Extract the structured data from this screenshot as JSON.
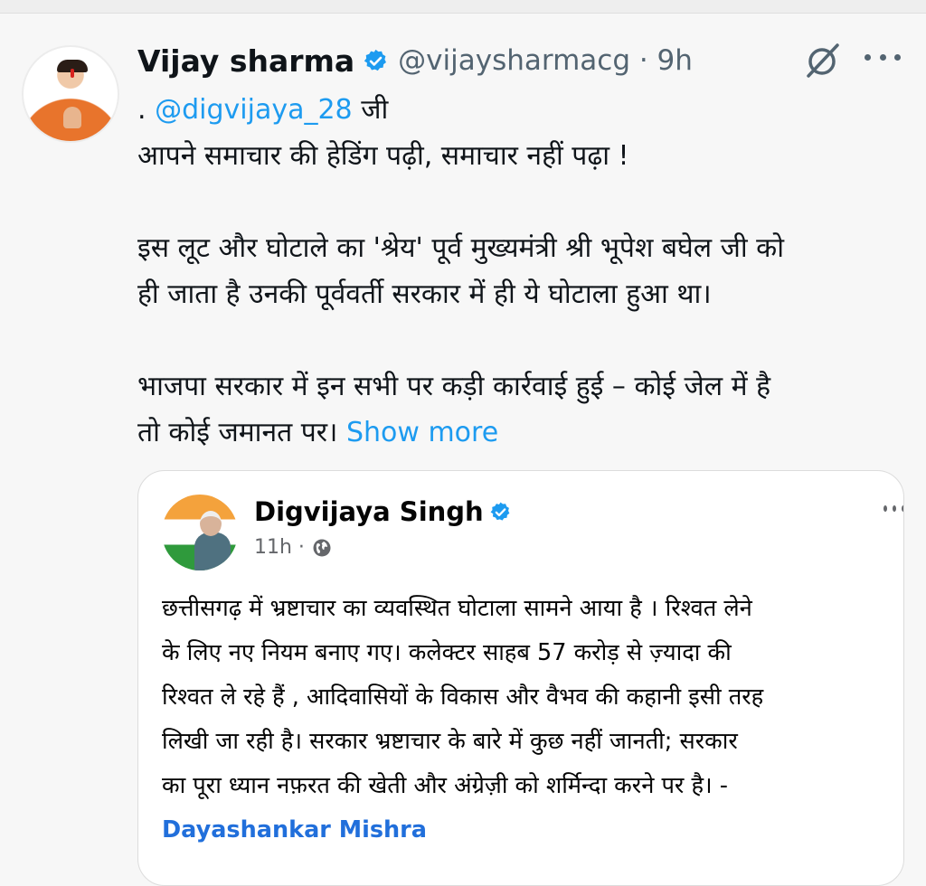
{
  "tweet": {
    "author_name": "Vijay sharma",
    "handle_time": "@vijaysharmacg · 9h",
    "mention": "@digvijaya_28",
    "mention_prefix": ".",
    "mention_suffix": "जी",
    "lines": [
      "आपने समाचार की हेडिंग पढ़ी, समाचार नहीं पढ़ा !",
      "इस लूट और घोटाले का 'श्रेय' पूर्व मुख्यमंत्री श्री भूपेश बघेल जी को",
      "ही जाता है उनकी पूर्ववर्ती सरकार में ही ये घोटाला हुआ था।",
      "भाजपा सरकार में इन सभी पर कड़ी कार्रवाई हुई – कोई जेल में है",
      "तो कोई जमानत पर।"
    ],
    "show_more": "Show more",
    "icons": [
      "verified-icon",
      "grok-icon",
      "more-icon"
    ]
  },
  "quoted_post": {
    "author_name": "Digvijaya Singh",
    "time": "11h ·",
    "lines": [
      "छत्तीसगढ़ में भ्रष्टाचार का व्यवस्थित घोटाला सामने आया है । रिश्वत लेने",
      "के लिए नए नियम बनाए गए। कलेक्टर साहब 57 करोड़ से ज़्यादा की",
      "रिश्वत ले रहे हैं , आदिवासियों के विकास और वैभव की कहानी इसी तरह",
      "लिखी जा रही है। सरकार भ्रष्टाचार के बारे में कुछ नहीं जानती; सरकार",
      "का पूरा ध्यान नफ़रत की खेती और अंग्रेज़ी को शर्मिन्दा करने पर है। -"
    ],
    "quoted_author": "Dayashankar Mishra",
    "icons": [
      "verified-icon",
      "globe-icon",
      "more-icon"
    ]
  },
  "colors": {
    "link": "#1d9bf0",
    "verified": "#1d9bf0",
    "quoted_author": "#216fdb",
    "background": "#f7f7f7"
  }
}
